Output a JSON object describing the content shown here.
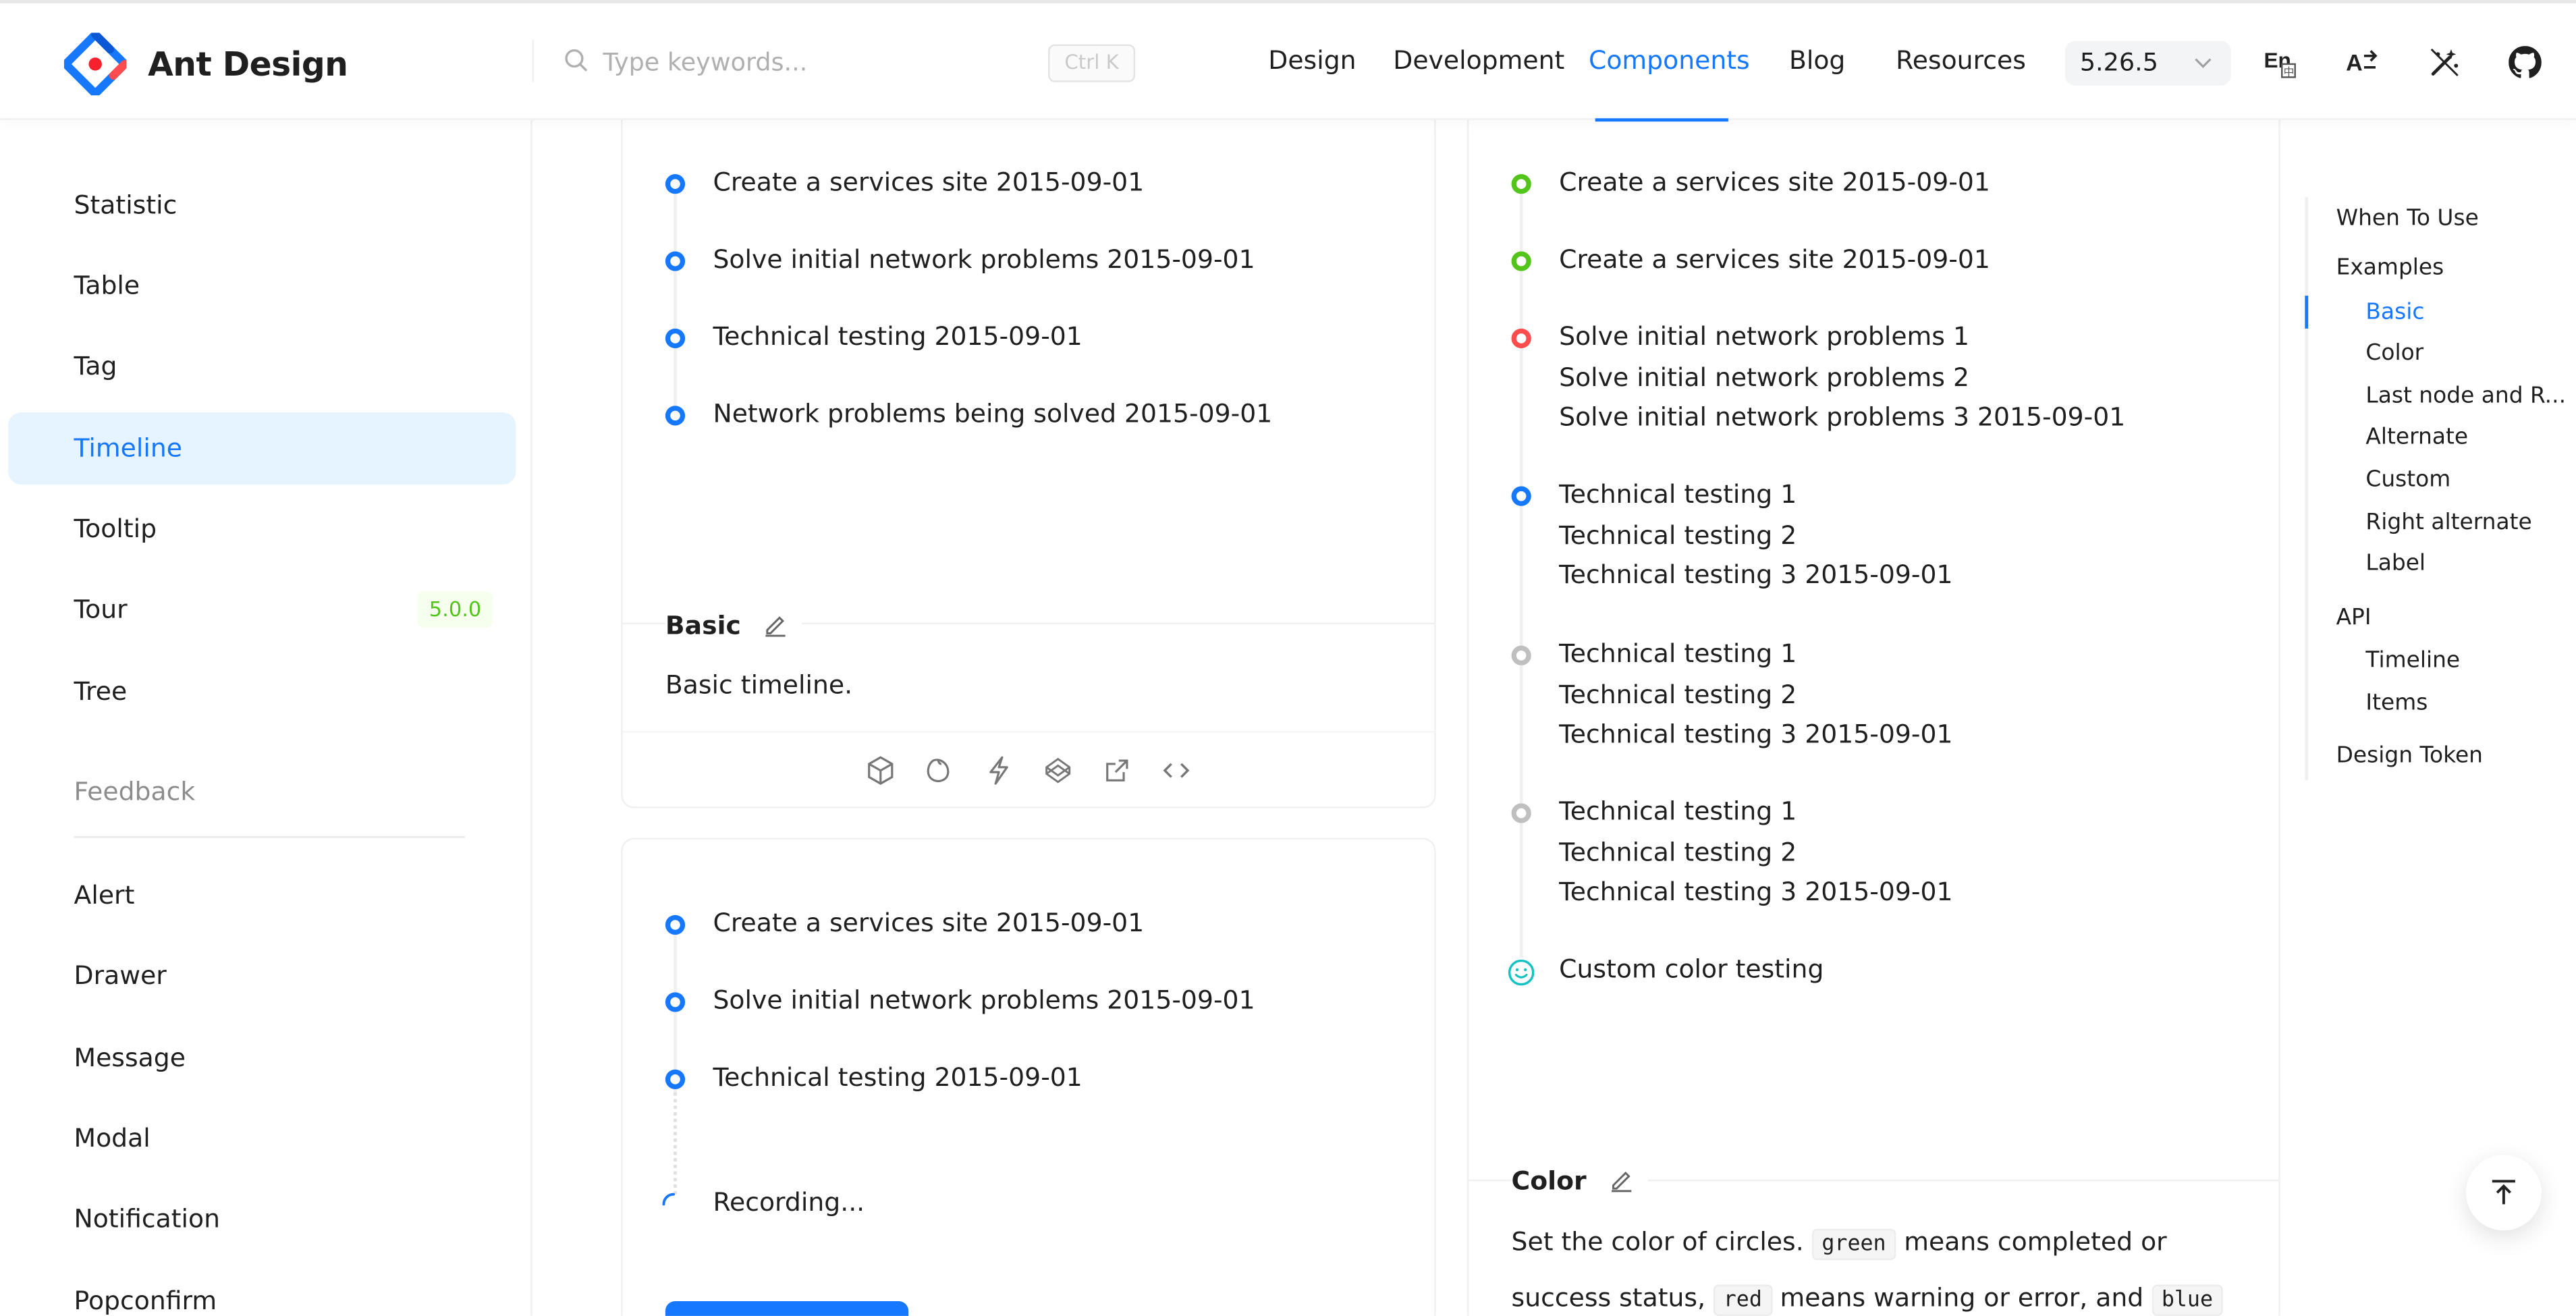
{
  "header": {
    "logo_text": "Ant Design",
    "search_placeholder": "Type keywords...",
    "search_shortcut": "Ctrl K",
    "nav": [
      "Design",
      "Development",
      "Components",
      "Blog",
      "Resources"
    ],
    "version": "5.26.5",
    "icons": [
      "language-switch-icon",
      "direction-icon",
      "theme-icon",
      "github-icon"
    ]
  },
  "sidebar": {
    "items_top": [
      {
        "label": "Statistic"
      },
      {
        "label": "Table"
      },
      {
        "label": "Tag"
      },
      {
        "label": "Timeline",
        "active": true
      },
      {
        "label": "Tooltip"
      },
      {
        "label": "Tour",
        "badge": "5.0.0"
      },
      {
        "label": "Tree"
      }
    ],
    "group_label": "Feedback",
    "items_feedback": [
      {
        "label": "Alert"
      },
      {
        "label": "Drawer"
      },
      {
        "label": "Message"
      },
      {
        "label": "Modal"
      },
      {
        "label": "Notification"
      },
      {
        "label": "Popconfirm"
      }
    ]
  },
  "basic_demo": {
    "items": [
      "Create a services site 2015-09-01",
      "Solve initial network problems 2015-09-01",
      "Technical testing 2015-09-01",
      "Network problems being solved 2015-09-01"
    ],
    "title": "Basic",
    "description": "Basic timeline.",
    "dot_color": "#1677ff"
  },
  "pending_demo": {
    "items": [
      "Create a services site 2015-09-01",
      "Solve initial network problems 2015-09-01",
      "Technical testing 2015-09-01"
    ],
    "pending": "Recording..."
  },
  "color_demo": {
    "items": [
      {
        "lines": [
          "Create a services site 2015-09-01"
        ],
        "color": "#52c41a"
      },
      {
        "lines": [
          "Create a services site 2015-09-01"
        ],
        "color": "#52c41a"
      },
      {
        "lines": [
          "Solve initial network problems 1",
          "Solve initial network problems 2",
          "Solve initial network problems 3 2015-09-01"
        ],
        "color": "#ff4d4f"
      },
      {
        "lines": [
          "Technical testing 1",
          "Technical testing 2",
          "Technical testing 3 2015-09-01"
        ],
        "color": "#1677ff"
      },
      {
        "lines": [
          "Technical testing 1",
          "Technical testing 2",
          "Technical testing 3 2015-09-01"
        ],
        "color": "#bfbfbf"
      },
      {
        "lines": [
          "Technical testing 1",
          "Technical testing 2",
          "Technical testing 3 2015-09-01"
        ],
        "color": "#bfbfbf"
      },
      {
        "lines": [
          "Custom color testing"
        ],
        "color": "#13c2c2",
        "icon": "smile-icon"
      }
    ],
    "title": "Color",
    "desc_before_green": "Set the color of circles.",
    "code_green": "green",
    "desc_after_green": "means completed or",
    "desc_line2_start": "success status,",
    "code_red": "red",
    "desc_after_red": "means warning or error, and",
    "code_blue": "blue"
  },
  "toc": {
    "items": [
      {
        "label": "When To Use",
        "level": 1
      },
      {
        "label": "Examples",
        "level": 1
      },
      {
        "label": "Basic",
        "level": 2,
        "active": true
      },
      {
        "label": "Color",
        "level": 2
      },
      {
        "label": "Last node and R...",
        "level": 2
      },
      {
        "label": "Alternate",
        "level": 2
      },
      {
        "label": "Custom",
        "level": 2
      },
      {
        "label": "Right alternate",
        "level": 2
      },
      {
        "label": "Label",
        "level": 2
      },
      {
        "label": "API",
        "level": 1
      },
      {
        "label": "Timeline",
        "level": 2
      },
      {
        "label": "Items",
        "level": 2
      },
      {
        "label": "Design Token",
        "level": 1
      }
    ]
  },
  "colors": {
    "primary": "#1677ff",
    "active_bg": "#e6f4ff",
    "green": "#52c41a",
    "red": "#ff4d4f",
    "gray": "#bfbfbf",
    "cyan": "#13c2c2"
  }
}
